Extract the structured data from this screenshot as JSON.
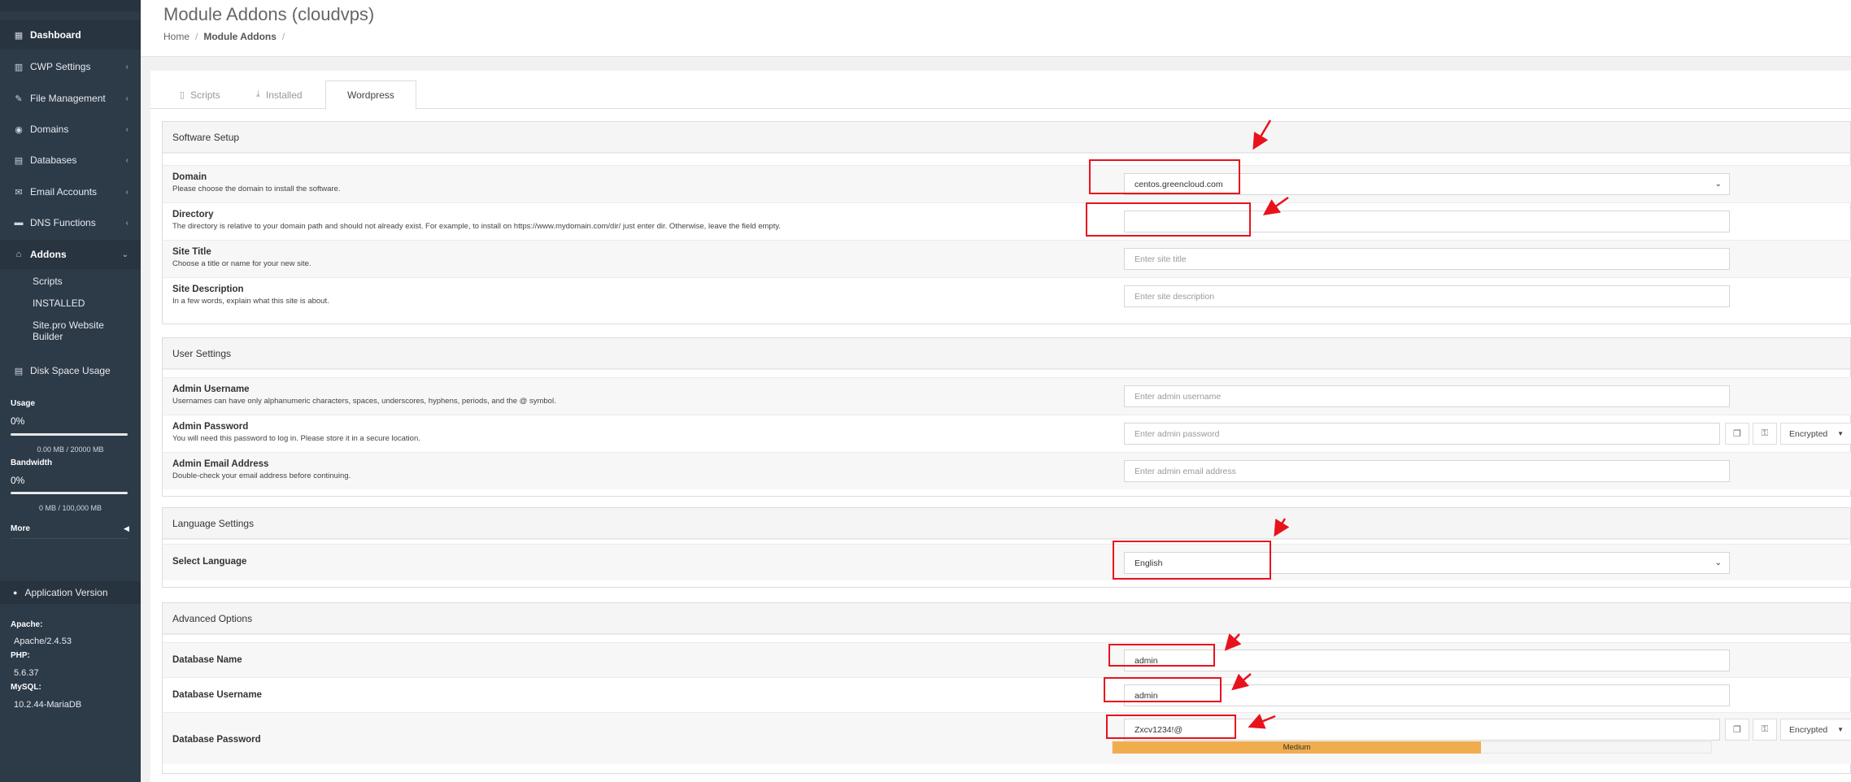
{
  "sidebar": {
    "nav": [
      {
        "label": "Dashboard",
        "icon": "dashboard-icon",
        "glyph": "▦"
      },
      {
        "label": "CWP Settings",
        "icon": "chart-icon",
        "glyph": "▥"
      },
      {
        "label": "File Management",
        "icon": "edit-icon",
        "glyph": "✎"
      },
      {
        "label": "Domains",
        "icon": "globe-icon",
        "glyph": "◉"
      },
      {
        "label": "Databases",
        "icon": "database-icon",
        "glyph": "▤"
      },
      {
        "label": "Email Accounts",
        "icon": "envelope-icon",
        "glyph": "✉"
      },
      {
        "label": "DNS Functions",
        "icon": "server-icon",
        "glyph": "▬"
      },
      {
        "label": "Addons",
        "icon": "bank-icon",
        "glyph": "⌂"
      }
    ],
    "addons_sub": [
      "Scripts",
      "INSTALLED",
      "Site.pro Website",
      "Builder"
    ],
    "disk_space": "Disk Space Usage",
    "usage": {
      "label": "Usage",
      "percent": "0%",
      "value": "0.00 MB / 20000 MB",
      "fill": 0
    },
    "bandwidth": {
      "label": "Bandwidth",
      "percent": "0%",
      "value": "0 MB / 100,000 MB",
      "fill": 0
    },
    "more": "More",
    "app_version": "Application Version",
    "software": [
      {
        "name": "Apache:",
        "version": "Apache/2.4.53"
      },
      {
        "name": "PHP:",
        "version": "5.6.37"
      },
      {
        "name": "MySQL:",
        "version": "10.2.44-MariaDB"
      }
    ]
  },
  "header": {
    "title": "Module Addons (cloudvps)",
    "breadcrumb": [
      "Home",
      "Module Addons"
    ]
  },
  "tabs": [
    {
      "label": "Scripts",
      "icon": "file-icon"
    },
    {
      "label": "Installed",
      "icon": "download-icon"
    },
    {
      "label": "Wordpress",
      "icon": ""
    }
  ],
  "software_setup": {
    "title": "Software Setup",
    "domain": {
      "label": "Domain",
      "hint": "Please choose the domain to install the software.",
      "value": "centos.greencloud.com"
    },
    "directory": {
      "label": "Directory",
      "hint": "The directory is relative to your domain path and should not already exist. For example, to install on https://www.mydomain.com/dir/ just enter dir. Otherwise, leave the field empty.",
      "value": ""
    },
    "site_title": {
      "label": "Site Title",
      "hint": "Choose a title or name for your new site.",
      "placeholder": "Enter site title"
    },
    "site_description": {
      "label": "Site Description",
      "hint": "In a few words, explain what this site is about.",
      "placeholder": "Enter site description"
    }
  },
  "user_settings": {
    "title": "User Settings",
    "admin_username": {
      "label": "Admin Username",
      "hint": "Usernames can have only alphanumeric characters, spaces, underscores, hyphens, periods, and the @ symbol.",
      "placeholder": "Enter admin username"
    },
    "admin_password": {
      "label": "Admin Password",
      "hint": "You will need this password to log in. Please store it in a secure location.",
      "placeholder": "Enter admin password",
      "mode": "Encrypted"
    },
    "admin_email": {
      "label": "Admin Email Address",
      "hint": "Double-check your email address before continuing.",
      "placeholder": "Enter admin email address"
    }
  },
  "language_settings": {
    "title": "Language Settings",
    "select_language": {
      "label": "Select Language",
      "value": "English"
    }
  },
  "advanced_options": {
    "title": "Advanced Options",
    "db_name": {
      "label": "Database Name",
      "value": "admin"
    },
    "db_username": {
      "label": "Database Username",
      "value": "admin"
    },
    "db_password": {
      "label": "Database Password",
      "value": "Zxcv1234!@",
      "mode": "Encrypted",
      "strength": "Medium",
      "strength_fill": 0.615
    }
  },
  "colors": {
    "annotation": "#e8121d",
    "sidebar": "#2d3a48",
    "strength": "#f0ad4e"
  }
}
